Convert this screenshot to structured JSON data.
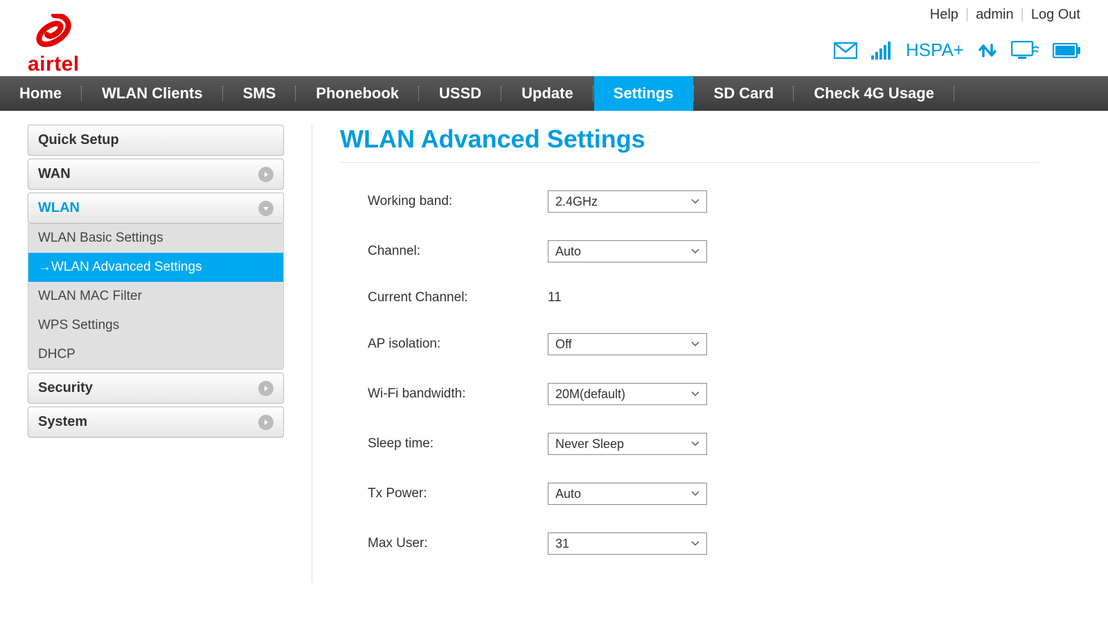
{
  "brand": "airtel",
  "top_links": {
    "help": "Help",
    "user": "admin",
    "logout": "Log Out"
  },
  "status": {
    "network_type": "HSPA+"
  },
  "nav": {
    "items": [
      {
        "label": "Home"
      },
      {
        "label": "WLAN Clients"
      },
      {
        "label": "SMS"
      },
      {
        "label": "Phonebook"
      },
      {
        "label": "USSD"
      },
      {
        "label": "Update"
      },
      {
        "label": "Settings",
        "active": true
      },
      {
        "label": "SD Card"
      },
      {
        "label": "Check 4G Usage"
      }
    ]
  },
  "sidebar": {
    "quick_setup": "Quick Setup",
    "wan": "WAN",
    "wlan": {
      "label": "WLAN",
      "items": [
        {
          "label": "WLAN Basic Settings"
        },
        {
          "label": "WLAN Advanced Settings",
          "active": true,
          "prefix": "→"
        },
        {
          "label": "WLAN MAC Filter"
        },
        {
          "label": "WPS Settings"
        },
        {
          "label": "DHCP"
        }
      ]
    },
    "security": "Security",
    "system": "System"
  },
  "page": {
    "title": "WLAN Advanced Settings",
    "fields": {
      "working_band": {
        "label": "Working band:",
        "value": "2.4GHz",
        "type": "select"
      },
      "channel": {
        "label": "Channel:",
        "value": "Auto",
        "type": "select"
      },
      "current_channel": {
        "label": "Current Channel:",
        "value": "11",
        "type": "text"
      },
      "ap_isolation": {
        "label": "AP isolation:",
        "value": "Off",
        "type": "select"
      },
      "wifi_bandwidth": {
        "label": "Wi-Fi bandwidth:",
        "value": "20M(default)",
        "type": "select"
      },
      "sleep_time": {
        "label": "Sleep time:",
        "value": "Never Sleep",
        "type": "select"
      },
      "tx_power": {
        "label": "Tx Power:",
        "value": "Auto",
        "type": "select"
      },
      "max_user": {
        "label": "Max User:",
        "value": "31",
        "type": "select"
      }
    }
  }
}
